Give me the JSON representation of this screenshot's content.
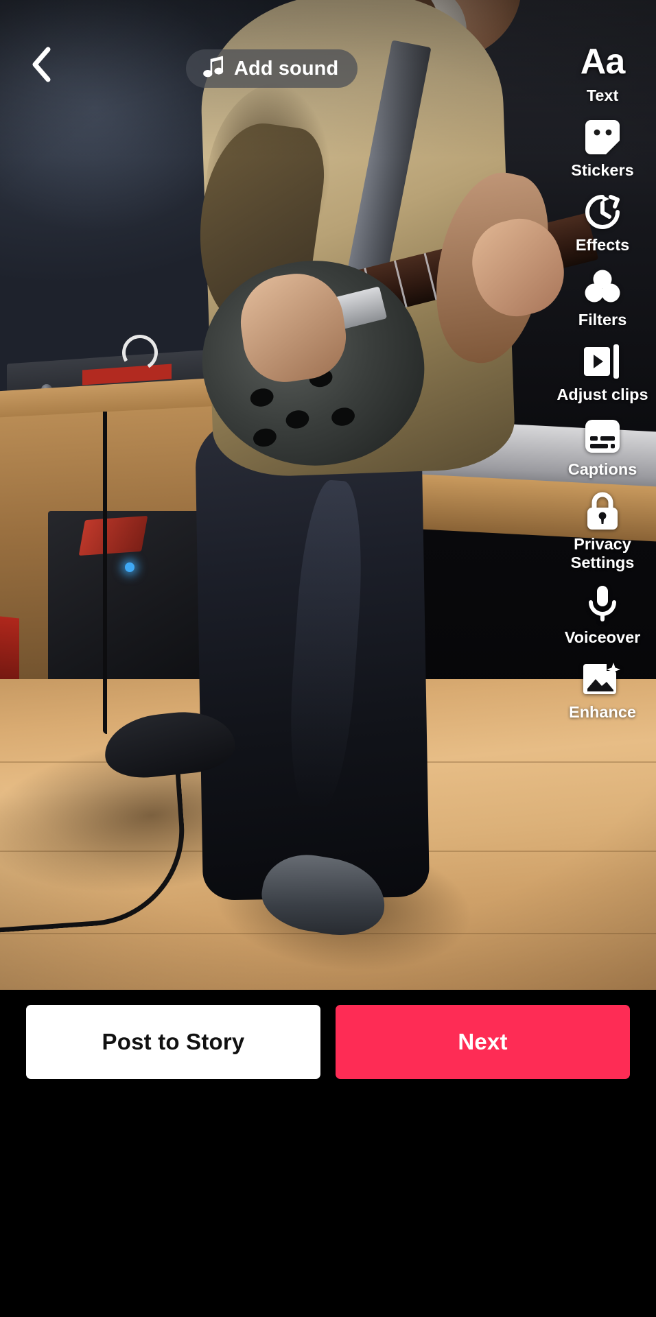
{
  "screen": {
    "name": "TikTok video post-capture editor",
    "background_color": "#000000"
  },
  "top_bar": {
    "back_icon": "chevron-left-icon",
    "add_sound": {
      "icon": "music-note-icon",
      "label": "Add sound"
    }
  },
  "sidebar": {
    "items": [
      {
        "icon": "text-aa-icon",
        "glyph": "Aa",
        "label": "Text"
      },
      {
        "icon": "sticker-icon",
        "label": "Stickers"
      },
      {
        "icon": "effects-clock-icon",
        "label": "Effects"
      },
      {
        "icon": "filters-circles-icon",
        "label": "Filters"
      },
      {
        "icon": "adjust-clips-icon",
        "label": "Adjust clips"
      },
      {
        "icon": "captions-icon",
        "label": "Captions"
      },
      {
        "icon": "lock-icon",
        "label": "Privacy\nSettings"
      },
      {
        "icon": "microphone-icon",
        "label": "Voiceover"
      },
      {
        "icon": "enhance-image-icon",
        "label": "Enhance"
      }
    ]
  },
  "bottom_bar": {
    "post_to_story_label": "Post to Story",
    "next_label": "Next",
    "next_color": "#FE2C55",
    "post_color": "#FFFFFF"
  }
}
